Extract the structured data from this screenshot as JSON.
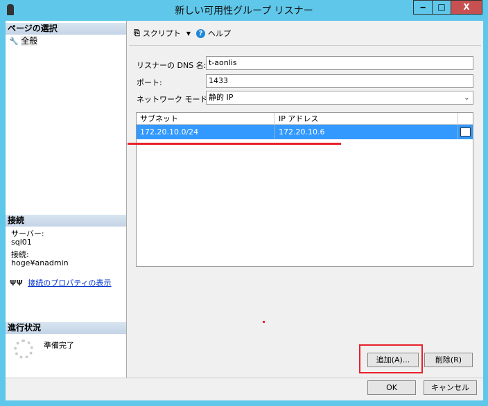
{
  "window": {
    "title": "新しい可用性グループ リスナー",
    "minimize": "‒",
    "maximize": "□",
    "close": "X"
  },
  "sidebar": {
    "select_page_header": "ページの選択",
    "pages": [
      {
        "label": "全般"
      }
    ],
    "connection_header": "接続",
    "server_label": "サーバー:",
    "server_value": "sql01",
    "connection_label": "接続:",
    "connection_value": "hoge¥anadmin",
    "view_properties_link": "接続のプロパティの表示",
    "progress_header": "進行状況",
    "progress_status": "準備完了"
  },
  "toolbar": {
    "script_label": "スクリプト",
    "help_label": "ヘルプ"
  },
  "form": {
    "dns_label": "リスナーの DNS 名:",
    "dns_value": "t-aonlis",
    "port_label": "ポート:",
    "port_value": "1433",
    "network_mode_label": "ネットワーク モード:",
    "network_mode_value": "静的 IP"
  },
  "grid": {
    "columns": [
      "サブネット",
      "IP アドレス"
    ],
    "rows": [
      {
        "subnet": "172.20.10.0/24",
        "ip": "172.20.10.6"
      }
    ]
  },
  "buttons": {
    "add": "追加(A)...",
    "remove": "削除(R)",
    "ok": "OK",
    "cancel": "キャンセル"
  },
  "colors": {
    "accent": "#5fc7ea",
    "selection": "#3399ff",
    "annotation": "#e8202a"
  }
}
